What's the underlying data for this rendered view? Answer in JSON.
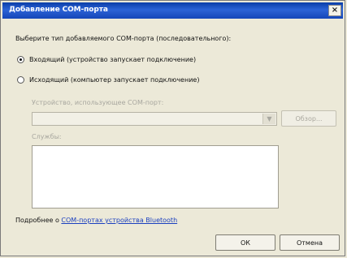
{
  "window": {
    "title": "Добавление COM-порта",
    "close_glyph": "×"
  },
  "dialog": {
    "prompt": "Выберите тип добавляемого COM-порта (последовательного):",
    "radio_incoming": "Входящий (устройство запускает подключение)",
    "radio_outgoing": "Исходящий (компьютер запускает подключение)",
    "device_label": "Устройство, использующее COM-порт:",
    "device_value": "",
    "browse_button": "Обзор...",
    "service_label": "Службы:",
    "footer_text": "Подробнее о ",
    "footer_link": "COM-портах устройства Bluetooth",
    "ok_button": "ОК",
    "cancel_button": "Отмена"
  }
}
